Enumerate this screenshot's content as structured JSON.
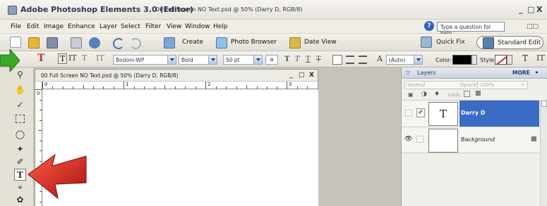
{
  "window": {
    "app_title": "Adobe Photoshop Elements 3.0 (Editor)",
    "doc_title": "00 Full Screen NO Text.psd @ 50% (Darry D, RGB/8)",
    "minimize": "_",
    "maximize": "□",
    "close": "X"
  },
  "menus": [
    "File",
    "Edit",
    "Image",
    "Enhance",
    "Layer",
    "Select",
    "Filter",
    "View",
    "Window",
    "Help"
  ],
  "help": {
    "placeholder": "Type a question for help"
  },
  "toolbar": {
    "create_label": "Create",
    "photo_browser_label": "Photo Browser",
    "date_view_label": "Date View",
    "quick_fix_label": "Quick Fix",
    "standard_edit_label": "Standard Edit"
  },
  "options_bar": {
    "font_family": "Bodoni-WP",
    "font_style": "Bold",
    "font_size": "50 pt",
    "aa": "a",
    "leading": "(Auto)",
    "color_label": "Color:",
    "style_label": "Style:"
  },
  "document": {
    "title": "00 Full Screen NO Text.psd @ 50% (Darry D, RGB/8)",
    "ruler_labels": [
      "0",
      "1",
      "2",
      "3"
    ]
  },
  "layers_panel": {
    "title": "Layers",
    "more": "MORE",
    "blend_mode": "Normal",
    "opacity_label": "Opacity:",
    "opacity_value": "100%",
    "lock_label": "Lock:",
    "layers": [
      {
        "name": "Darry D",
        "type": "text",
        "selected": true
      },
      {
        "name": "Background",
        "type": "image",
        "selected": false
      }
    ]
  },
  "colors": {
    "accent": "#3a6bc5",
    "arrow_red": "#d62a1e",
    "arrow_green": "#3aa82a"
  }
}
